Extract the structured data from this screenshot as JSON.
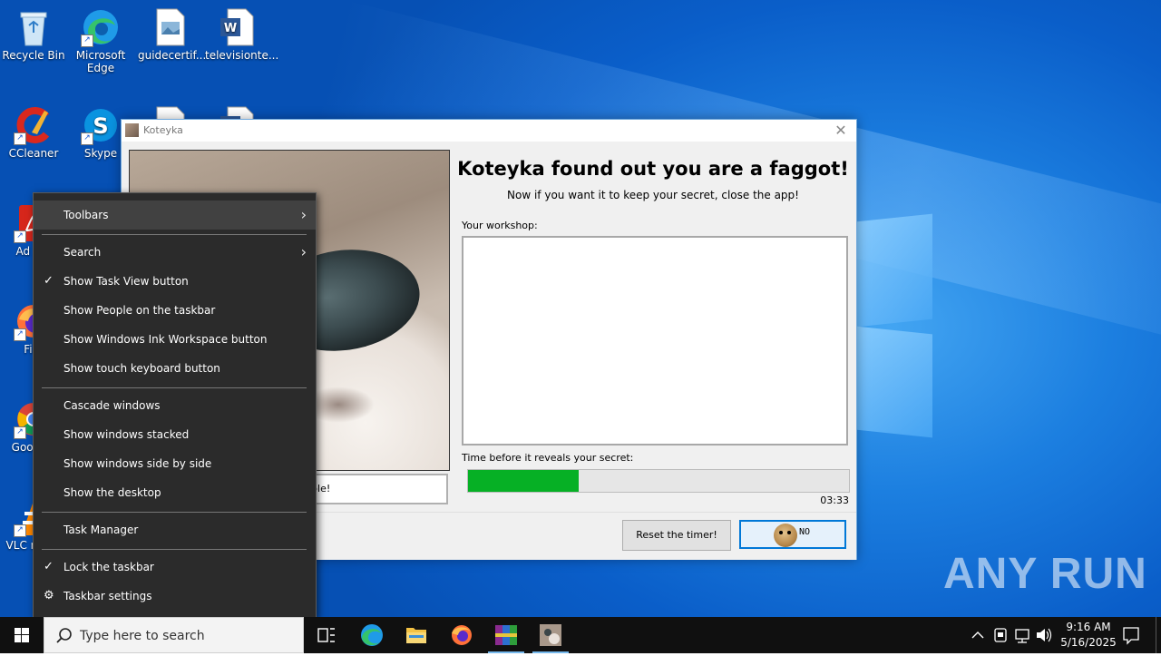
{
  "desktop": {
    "icons": [
      {
        "label": "Recycle Bin"
      },
      {
        "label": "Microsoft Edge"
      },
      {
        "label": "guidecertif..."
      },
      {
        "label": "televisionte..."
      },
      {
        "label": "CCleaner"
      },
      {
        "label": "Skype"
      },
      {
        "label": "Ad Acr"
      },
      {
        "label": "Fire"
      },
      {
        "label": "Goo Chr"
      },
      {
        "label": "VLC m pla"
      }
    ],
    "watermark": "ANY RUN"
  },
  "window": {
    "title": "Koteyka",
    "headline": "Koteyka found out you are a faggot!",
    "subline": "Now if you want it to keep your secret, close the app!",
    "workshop_label": "Your workshop:",
    "timer_label": "Time before it reveals your secret:",
    "progress_fraction": 0.29,
    "timer_value": "03:33",
    "partial_text": "ible!",
    "reset_button": "Reset the timer!",
    "no_button": "NO"
  },
  "context_menu": {
    "items": [
      {
        "label": "Toolbars",
        "submenu": true
      },
      {
        "label": "Search",
        "submenu": true
      },
      {
        "label": "Show Task View button",
        "checked": true
      },
      {
        "label": "Show People on the taskbar"
      },
      {
        "label": "Show Windows Ink Workspace button"
      },
      {
        "label": "Show touch keyboard button"
      },
      {
        "label": "Cascade windows"
      },
      {
        "label": "Show windows stacked"
      },
      {
        "label": "Show windows side by side"
      },
      {
        "label": "Show the desktop"
      },
      {
        "label": "Task Manager"
      },
      {
        "label": "Lock the taskbar",
        "checked": true
      },
      {
        "label": "Taskbar settings"
      }
    ]
  },
  "taskbar": {
    "search_placeholder": "Type here to search",
    "time": "9:16 AM",
    "date": "5/16/2025",
    "accent_color": "#76b9ed"
  }
}
